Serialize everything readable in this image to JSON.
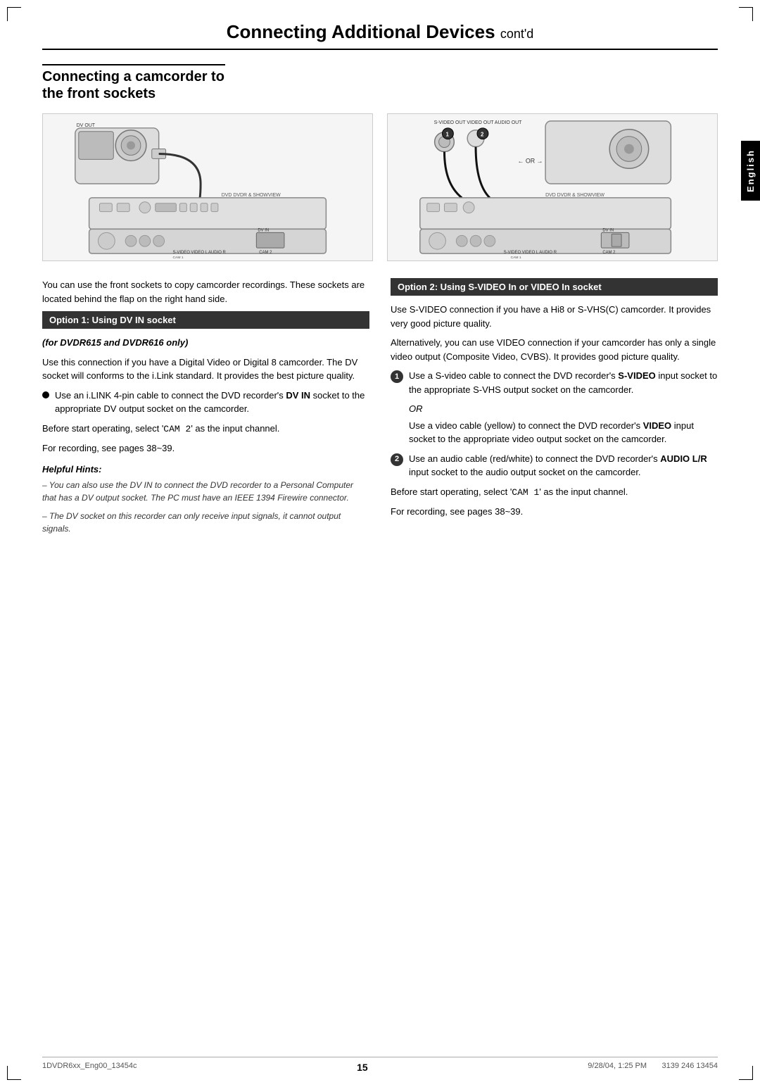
{
  "page": {
    "corner_marks": true,
    "main_title": "Connecting Additional Devices",
    "main_title_cont": "cont'd",
    "english_tab": "English",
    "section_heading_line1": "Connecting a camcorder to",
    "section_heading_line2": "the front sockets",
    "intro_text": "You can use the front sockets to copy camcorder recordings. These sockets are located behind the flap on the right hand side.",
    "option1": {
      "heading": "Option 1: Using DV IN socket",
      "sub_heading": "(for DVDR615 and DVDR616 only)",
      "para1": "Use this connection if you have a Digital Video or Digital 8 camcorder. The DV socket will conforms to the i.Link standard. It provides the best picture quality.",
      "bullet1": "Use an i.LINK 4-pin cable to connect the DVD recorder's DV IN socket to the appropriate DV output socket on the camcorder.",
      "dv_in_bold": "DV IN",
      "para2_prefix": "Before start operating, select '",
      "para2_code": "CAM 2",
      "para2_suffix": "' as the input channel.",
      "para3": "For recording, see pages 38~39.",
      "helpful_hints_head": "Helpful Hints:",
      "hint1": "– You can also use the DV IN to connect the DVD recorder to a Personal Computer that has a DV output socket. The PC must have an IEEE 1394 Firewire connector.",
      "hint2": "– The DV socket on this recorder can only receive input signals, it cannot output signals."
    },
    "option2": {
      "heading": "Option 2: Using S-VIDEO In or VIDEO In socket",
      "para1": "Use S-VIDEO connection if you have a Hi8 or S-VHS(C) camcorder. It provides very good picture quality.",
      "para2": "Alternatively, you can use VIDEO connection if your camcorder has only a single video output (Composite Video, CVBS). It provides good picture quality.",
      "step1_prefix": "Use a S-video cable to connect the DVD recorder's ",
      "step1_bold": "S-VIDEO",
      "step1_suffix": " input socket to the appropriate S-VHS output socket on the camcorder.",
      "or_text": "OR",
      "step1b": "Use a video cable (yellow) to connect the DVD recorder's ",
      "step1b_bold": "VIDEO",
      "step1b_suffix": " input socket to the appropriate video output socket on the camcorder.",
      "step2_prefix": "Use an audio cable (red/white) to connect the DVD recorder's ",
      "step2_bold": "AUDIO L/R",
      "step2_suffix": " input socket to the audio output socket on the camcorder.",
      "para_before_prefix": "Before start operating, select '",
      "para_before_code": "CAM 1",
      "para_before_suffix": "' as the input channel.",
      "para_rec": "For recording, see pages 38~39."
    },
    "footer": {
      "left": "1DVDR6xx_Eng00_13454c",
      "center": "15",
      "right": "9/28/04, 1:25 PM",
      "far_right": "3139 246 13454"
    }
  }
}
